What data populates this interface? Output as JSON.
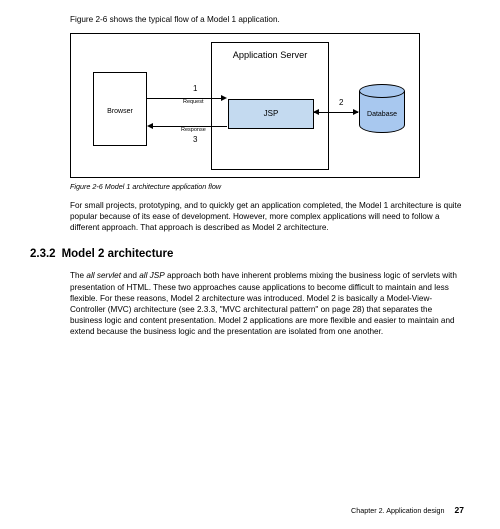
{
  "intro": "Figure 2-6 shows the typical flow of a Model 1 application.",
  "figure": {
    "caption_prefix": "Figure 2-6",
    "caption_rest": "  Model 1 architecture application flow",
    "appserver": "Application Server",
    "browser": "Browser",
    "jsp": "JSP",
    "database": "Database",
    "label1": "1",
    "label2": "2",
    "label3": "3",
    "request": "Request",
    "response": "Response"
  },
  "para1": "For small projects, prototyping, and to quickly get an application completed, the Model 1 architecture is quite popular because of its ease of development. However, more complex applications will need to follow a different approach. That approach is described as Model 2 architecture.",
  "section": {
    "number": "2.3.2",
    "title": "Model 2 architecture"
  },
  "para2_a": "The ",
  "para2_ital1": "all servlet",
  "para2_b": " and ",
  "para2_ital2": "all JSP",
  "para2_c": " approach both have inherent problems mixing the business logic of servlets with presentation of HTML. These two approaches cause applications to become difficult to maintain and less flexible. For these reasons, Model 2 architecture was introduced. Model 2 is basically a Model-View-Controller (MVC) architecture (see 2.3.3, \"MVC architectural pattern\" on page 28) that separates the business logic and content presentation. Model 2 applications are more flexible and easier to maintain and extend because the business logic and the presentation are isolated from one another.",
  "footer": {
    "chapter": "Chapter 2. Application design",
    "page": "27"
  }
}
